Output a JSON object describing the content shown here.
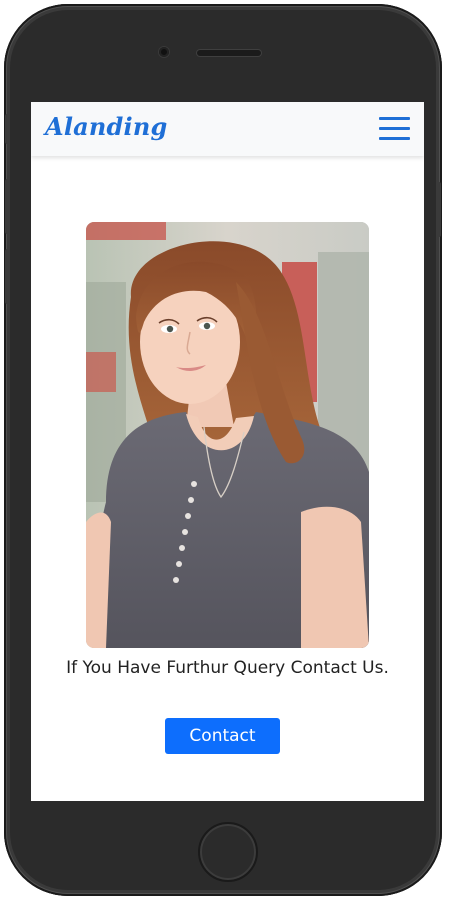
{
  "navbar": {
    "brand": "Alanding",
    "menu_icon": "hamburger-menu-icon",
    "brand_color": "#1f6fd6",
    "background": "#f8f9fa"
  },
  "hero": {
    "image": "profile-photo-woman",
    "caption": "If You Have Furthur Query Contact Us."
  },
  "cta": {
    "label": "Contact",
    "color": "#0d6efd"
  },
  "device": {
    "frame_color": "#2b2b2b"
  }
}
